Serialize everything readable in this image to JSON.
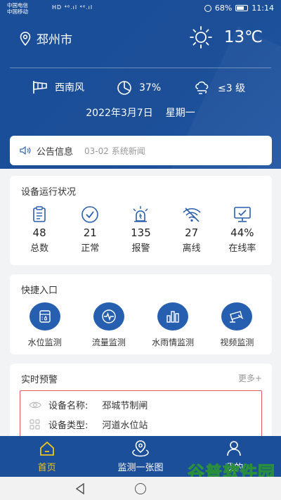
{
  "statusbar": {
    "carrier1": "中国电信",
    "carrier2": "中国移动",
    "signal": "HD ⁴⁶.ıl ⁴⁶.ıl",
    "battery": "68%",
    "time": "11:14"
  },
  "header": {
    "location": "邳州市",
    "temperature": "13℃",
    "wind": "西南风",
    "humidity": "37%",
    "wind_level": "≤3 级",
    "date": "2022年3月7日",
    "weekday": "星期一"
  },
  "notice": {
    "title": "公告信息",
    "message": "03-02 系统新闻"
  },
  "device_status": {
    "title": "设备运行状况",
    "items": [
      {
        "value": "48",
        "label": "总数",
        "icon": "clipboard-icon"
      },
      {
        "value": "21",
        "label": "正常",
        "icon": "check-circle-icon"
      },
      {
        "value": "135",
        "label": "报警",
        "icon": "alarm-light-icon"
      },
      {
        "value": "27",
        "label": "离线",
        "icon": "wifi-off-icon"
      },
      {
        "value": "44%",
        "label": "在线率",
        "icon": "monitor-icon"
      }
    ]
  },
  "quick_entry": {
    "title": "快捷入口",
    "items": [
      {
        "label": "水位监测",
        "icon": "water-level-icon"
      },
      {
        "label": "流量监测",
        "icon": "flow-icon"
      },
      {
        "label": "水雨情监测",
        "icon": "bar-chart-icon"
      },
      {
        "label": "视频监测",
        "icon": "camera-icon"
      }
    ]
  },
  "alerts": {
    "title": "实时预警",
    "more": "更多+",
    "device_name_label": "设备名称:",
    "device_name": "邳城节制闸",
    "device_type_label": "设备类型:",
    "device_type": "河道水位站"
  },
  "tabbar": {
    "tabs": [
      {
        "label": "首页",
        "icon": "home-icon",
        "active": true
      },
      {
        "label": "监测一张图",
        "icon": "map-pin-icon",
        "active": false
      },
      {
        "label": "我的",
        "icon": "user-icon",
        "active": false
      }
    ]
  },
  "watermark": {
    "title": "谷普软件园",
    "url": "www.gupuxiazai.com"
  },
  "colors": {
    "primary": "#1b4f99",
    "active_tab": "#f0c419",
    "alert_border": "#e25a5a"
  }
}
